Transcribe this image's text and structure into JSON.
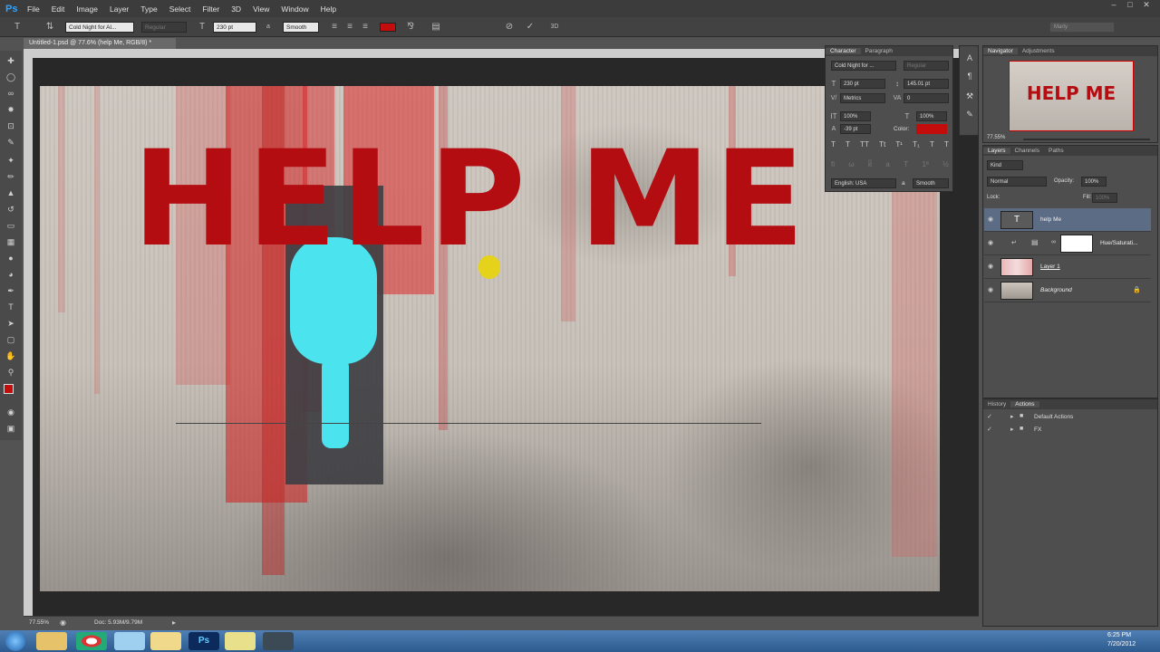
{
  "app": {
    "logo": "Ps",
    "user": "Marty"
  },
  "menu": [
    "File",
    "Edit",
    "Image",
    "Layer",
    "Type",
    "Select",
    "Filter",
    "3D",
    "View",
    "Window",
    "Help"
  ],
  "options": {
    "font_family": "Cold Night for Al...",
    "font_style": "Regular",
    "font_size": "230 pt",
    "antialias_label": "a",
    "antialias": "Smooth",
    "color": "#c30d0d"
  },
  "document": {
    "tab_title": "Untitled-1.psd @ 77.6% (help Me, RGB/8) *",
    "canvas_text": "HELP ME",
    "zoom": "77.55%",
    "doc_size": "Doc: 5.93M/9.79M"
  },
  "character": {
    "tabs": [
      "Character",
      "Paragraph"
    ],
    "font_family": "Cold Night for ...",
    "font_style": "Regular",
    "size": "230 pt",
    "leading": "145.01 pt",
    "kerning": "Metrics",
    "tracking": "0",
    "vscale": "100%",
    "hscale": "100%",
    "baseline": "-39 pt",
    "color_label": "Color:",
    "language": "English: USA",
    "antialias_label": "a",
    "antialias": "Smooth"
  },
  "navigator": {
    "tabs": [
      "Navigator",
      "Adjustments"
    ],
    "preview_text": "HELP ME",
    "zoom": "77.55%"
  },
  "layers": {
    "tabs": [
      "Layers",
      "Channels",
      "Paths"
    ],
    "filter_label": "Kind",
    "blend_mode": "Normal",
    "opacity_label": "Opacity:",
    "opacity": "100%",
    "lock_label": "Lock:",
    "fill_label": "Fill:",
    "fill": "100%",
    "items": [
      {
        "name": "help Me",
        "type": "text",
        "selected": true
      },
      {
        "name": "Hue/Saturati...",
        "type": "adjustment"
      },
      {
        "name": "Layer 1",
        "type": "pixel"
      },
      {
        "name": "Background",
        "type": "background",
        "locked": true
      }
    ]
  },
  "actions": {
    "tabs": [
      "History",
      "Actions"
    ],
    "items": [
      "Default Actions",
      "FX"
    ]
  },
  "taskbar": {
    "time": "6:25 PM",
    "date": "7/20/2012"
  },
  "colors": {
    "foreground": "#c30d0d",
    "background": "#ffffff",
    "accent": "#2fa3ff",
    "cyan_paint": "#4ae3ee"
  }
}
